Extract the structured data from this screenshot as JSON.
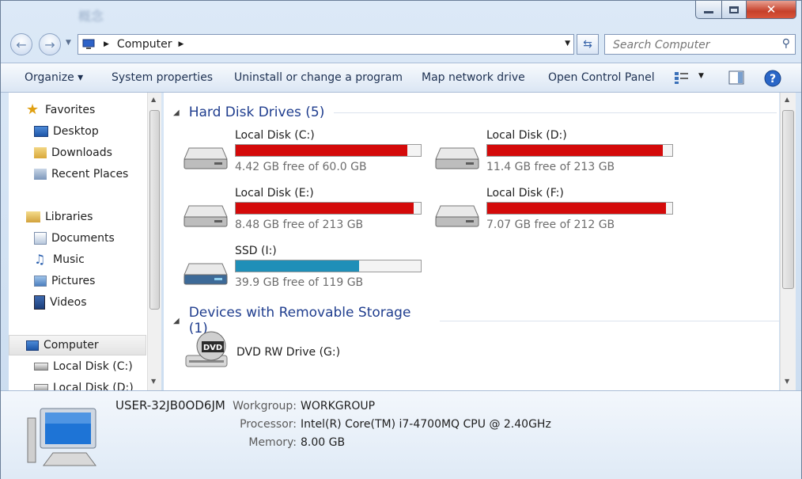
{
  "window": {
    "title_glyphs": "概念",
    "controls": {
      "minimize": "—",
      "maximize": "□",
      "close": "✕"
    }
  },
  "nav": {
    "breadcrumb": [
      "Computer"
    ],
    "search_placeholder": "Search Computer"
  },
  "toolbar": {
    "organize": "Organize ▾",
    "system_properties": "System properties",
    "uninstall": "Uninstall or change a program",
    "map_drive": "Map network drive",
    "control_panel": "Open Control Panel"
  },
  "sidebar": {
    "favorites": {
      "label": "Favorites",
      "items": [
        "Desktop",
        "Downloads",
        "Recent Places"
      ]
    },
    "libraries": {
      "label": "Libraries",
      "items": [
        "Documents",
        "Music",
        "Pictures",
        "Videos"
      ]
    },
    "computer": {
      "label": "Computer",
      "items": [
        "Local Disk (C:)",
        "Local Disk (D:)"
      ]
    }
  },
  "groups": {
    "hard_disks": {
      "title": "Hard Disk Drives (5)",
      "drives": [
        {
          "name": "Local Disk (C:)",
          "free": "4.42 GB free of 60.0 GB",
          "used_fraction": 0.926,
          "color": "#d40a0a"
        },
        {
          "name": "Local Disk (D:)",
          "free": "11.4 GB free of 213 GB",
          "used_fraction": 0.947,
          "color": "#d40a0a"
        },
        {
          "name": "Local Disk (E:)",
          "free": "8.48 GB free of 213 GB",
          "used_fraction": 0.96,
          "color": "#d40a0a"
        },
        {
          "name": "Local Disk (F:)",
          "free": "7.07 GB free of 212 GB",
          "used_fraction": 0.967,
          "color": "#d40a0a"
        },
        {
          "name": "SSD (I:)",
          "free": "39.9 GB free of 119 GB",
          "used_fraction": 0.665,
          "color": "#1f8fb8"
        }
      ]
    },
    "removable": {
      "title": "Devices with Removable Storage (1)",
      "devices": [
        {
          "name": "DVD RW Drive (G:)",
          "icon_label": "DVD"
        }
      ]
    }
  },
  "details": {
    "computer_name": "USER-32JB0OD6JM",
    "workgroup_label": "Workgroup:",
    "workgroup": "WORKGROUP",
    "processor_label": "Processor:",
    "processor": "Intel(R) Core(TM) i7-4700MQ CPU @ 2.40GHz",
    "memory_label": "Memory:",
    "memory": "8.00 GB"
  }
}
